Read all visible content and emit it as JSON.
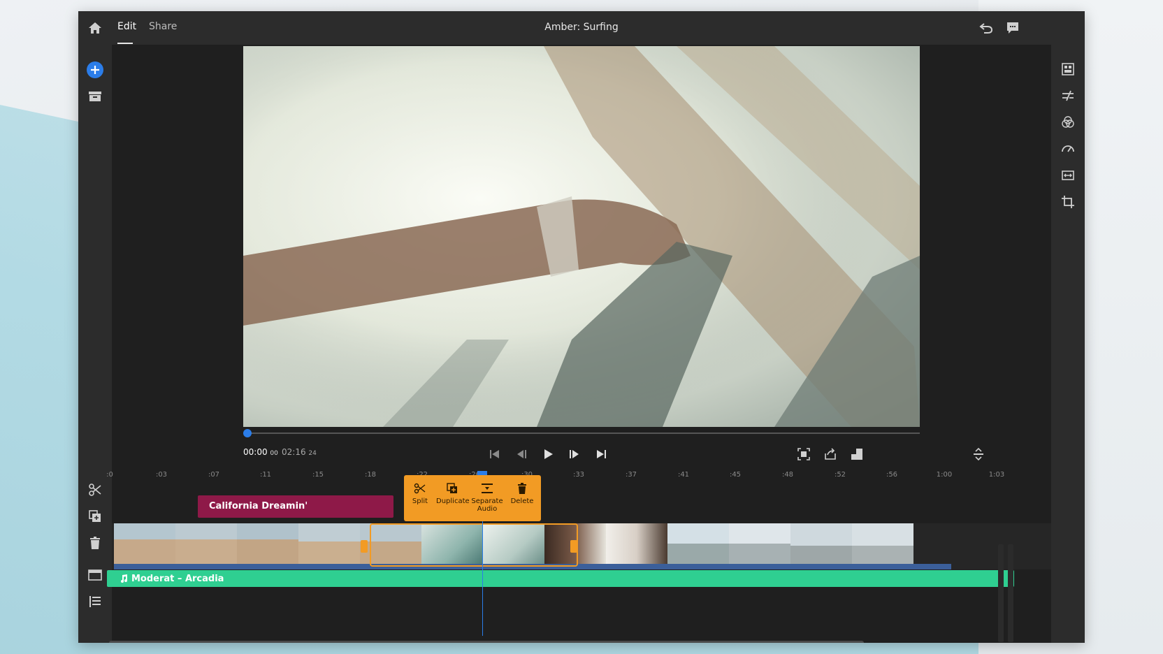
{
  "header": {
    "tabs": [
      {
        "label": "Edit",
        "active": true
      },
      {
        "label": "Share",
        "active": false
      }
    ],
    "title": "Amber: Surfing"
  },
  "icons": {
    "top_left": "home-icon",
    "top_right": [
      "undo-icon",
      "comment-icon"
    ],
    "left": [
      "add-media-icon",
      "project-bin-icon",
      "split-tool-icon",
      "duplicate-tool-icon",
      "delete-tool-icon",
      "title-tool-icon",
      "timeline-list-icon"
    ],
    "right": [
      "project-panel-icon",
      "transitions-icon",
      "color-icon",
      "speed-icon",
      "adjust-icon",
      "crop-icon"
    ]
  },
  "playback": {
    "current_time": "00:00",
    "current_frames": "00",
    "duration": "02:16",
    "duration_frames": "24",
    "progress": 0.0
  },
  "ruler": {
    "labels": [
      ":0",
      ":03",
      ":07",
      ":11",
      ":15",
      ":18",
      ":22",
      ":26",
      ":30",
      ":33",
      ":37",
      ":41",
      ":45",
      ":48",
      ":52",
      ":56",
      "1:00",
      "1:03"
    ]
  },
  "title_clip": {
    "label": "California Dreamin'"
  },
  "context_menu": {
    "items": [
      {
        "label": "Split",
        "icon": "scissors-icon"
      },
      {
        "label": "Duplicate",
        "icon": "duplicate-icon"
      },
      {
        "label": "Separate Audio",
        "icon": "separate-audio-icon"
      },
      {
        "label": "Delete",
        "icon": "trash-icon"
      }
    ]
  },
  "audio_track": {
    "label": "Moderat – Arcadia"
  },
  "colors": {
    "accent": "#2b7de9",
    "selection": "#f29b24",
    "title_clip": "#8e1948",
    "music_track": "#2fcf91",
    "panel": "#2c2c2c",
    "canvas": "#1f1f1f"
  }
}
